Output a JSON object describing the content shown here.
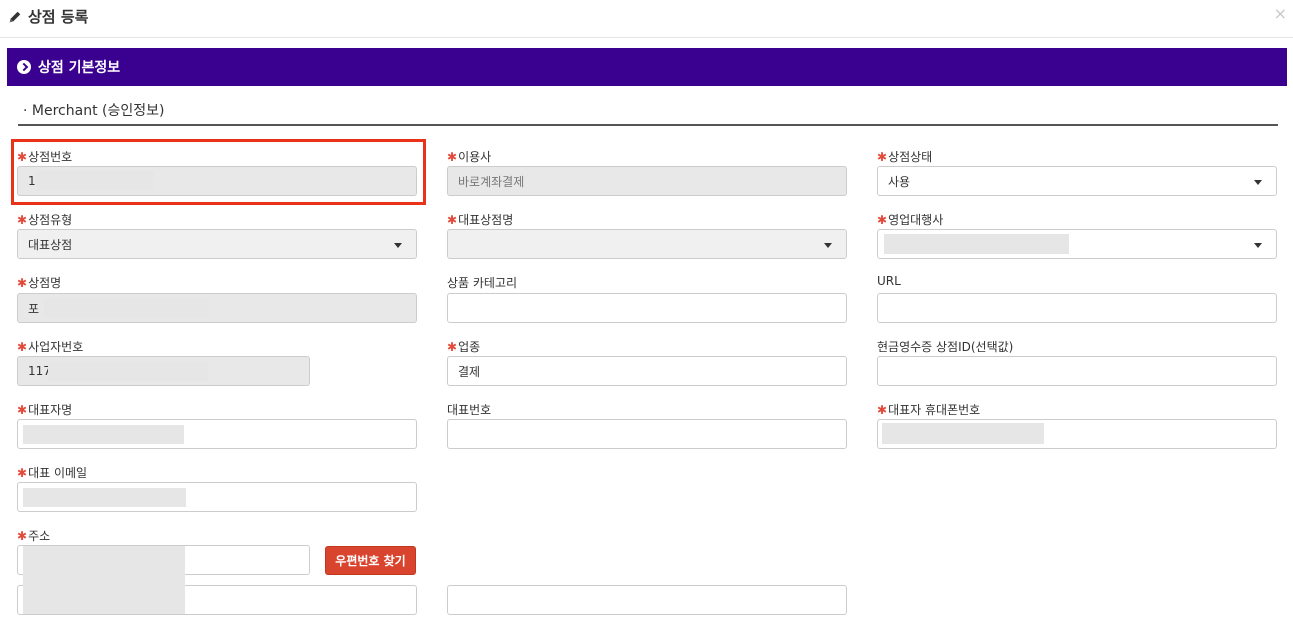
{
  "header": {
    "title": "상점 등록",
    "close_symbol": "×"
  },
  "section": {
    "title": "상점 기본정보",
    "subtitle": "· Merchant (승인정보)"
  },
  "required_mark": "✱",
  "fields": {
    "merchant_no": {
      "label": "상점번호",
      "value": "1"
    },
    "partner": {
      "label": "이용사",
      "value": "바로계좌결제"
    },
    "status": {
      "label": "상점상태",
      "value": "사용"
    },
    "merchant_type": {
      "label": "상점유형",
      "value": "대표상점"
    },
    "rep_merchant_name": {
      "label": "대표상점명",
      "value": ""
    },
    "sales_agency": {
      "label": "영업대행사",
      "value": ""
    },
    "merchant_name": {
      "label": "상점명",
      "value": "포"
    },
    "product_category": {
      "label": "상품 카테고리",
      "value": ""
    },
    "url": {
      "label": "URL",
      "value": ""
    },
    "business_no": {
      "label": "사업자번호",
      "value": "117"
    },
    "industry": {
      "label": "업종",
      "value": "결제"
    },
    "cash_receipt_id": {
      "label": "현금영수증 상점ID(선택값)",
      "value": ""
    },
    "ceo_name": {
      "label": "대표자명",
      "value": ""
    },
    "rep_phone": {
      "label": "대표번호",
      "value": ""
    },
    "ceo_mobile": {
      "label": "대표자 휴대폰번호",
      "value": ""
    },
    "rep_email": {
      "label": "대표 이메일",
      "value": ""
    },
    "address": {
      "label": "주소",
      "value": ""
    }
  },
  "buttons": {
    "find_zip": "우편번호 찾기"
  }
}
